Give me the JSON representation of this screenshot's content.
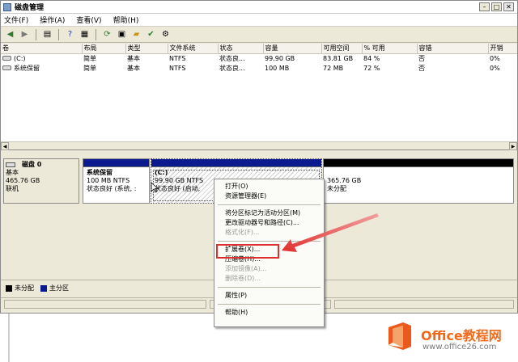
{
  "window": {
    "title": "磁盘管理"
  },
  "menubar": {
    "items": [
      "文件(F)",
      "操作(A)",
      "查看(V)",
      "帮助(H)"
    ]
  },
  "volume_table": {
    "headers": [
      "卷",
      "布局",
      "类型",
      "文件系统",
      "状态",
      "容量",
      "可用空间",
      "% 可用",
      "容错",
      "开销"
    ],
    "rows": [
      [
        "(C:)",
        "简单",
        "基本",
        "NTFS",
        "状态良...",
        "99.90 GB",
        "83.81 GB",
        "84 %",
        "否",
        "0%"
      ],
      [
        "系统保留",
        "简单",
        "基本",
        "NTFS",
        "状态良...",
        "100 MB",
        "72 MB",
        "72 %",
        "否",
        "0%"
      ]
    ]
  },
  "disk": {
    "name": "磁盘 0",
    "type": "基本",
    "size": "465.76 GB",
    "status": "联机"
  },
  "partitions": {
    "reserved": {
      "title": "系统保留",
      "line1": "100 MB NTFS",
      "line2": "状态良好 (系统, :"
    },
    "c_drive": {
      "title": "(C:)",
      "line1": "99.90 GB NTFS",
      "line2": "状态良好 (启动,"
    },
    "unalloc": {
      "size": "365.76 GB",
      "label": "未分配"
    }
  },
  "legend": {
    "items": [
      {
        "label": "未分配",
        "color": "#000000"
      },
      {
        "label": "主分区",
        "color": "#0b1b8f"
      }
    ]
  },
  "context_menu": {
    "group1": [
      {
        "label": "打开(O)",
        "enabled": true
      },
      {
        "label": "资源管理器(E)",
        "enabled": true
      }
    ],
    "group2": [
      {
        "label": "将分区标记为活动分区(M)",
        "enabled": true
      },
      {
        "label": "更改驱动器号和路径(C)...",
        "enabled": true
      },
      {
        "label": "格式化(F)...",
        "enabled": false
      }
    ],
    "group3": [
      {
        "label": "扩展卷(X)...",
        "enabled": true
      },
      {
        "label": "压缩卷(H)...",
        "enabled": true
      },
      {
        "label": "添加镜像(A)...",
        "enabled": false
      },
      {
        "label": "删除卷(D)...",
        "enabled": false
      }
    ],
    "group4": [
      {
        "label": "属性(P)",
        "enabled": true
      }
    ],
    "group5": [
      {
        "label": "帮助(H)",
        "enabled": true
      }
    ]
  },
  "watermark": {
    "title": "Office教程网",
    "url": "www.office26.com"
  },
  "colors": {
    "accent_red": "#e0302e",
    "primary_partition": "#0b1b8f",
    "unallocated": "#000000",
    "watermark_orange": "#f06a1c"
  }
}
